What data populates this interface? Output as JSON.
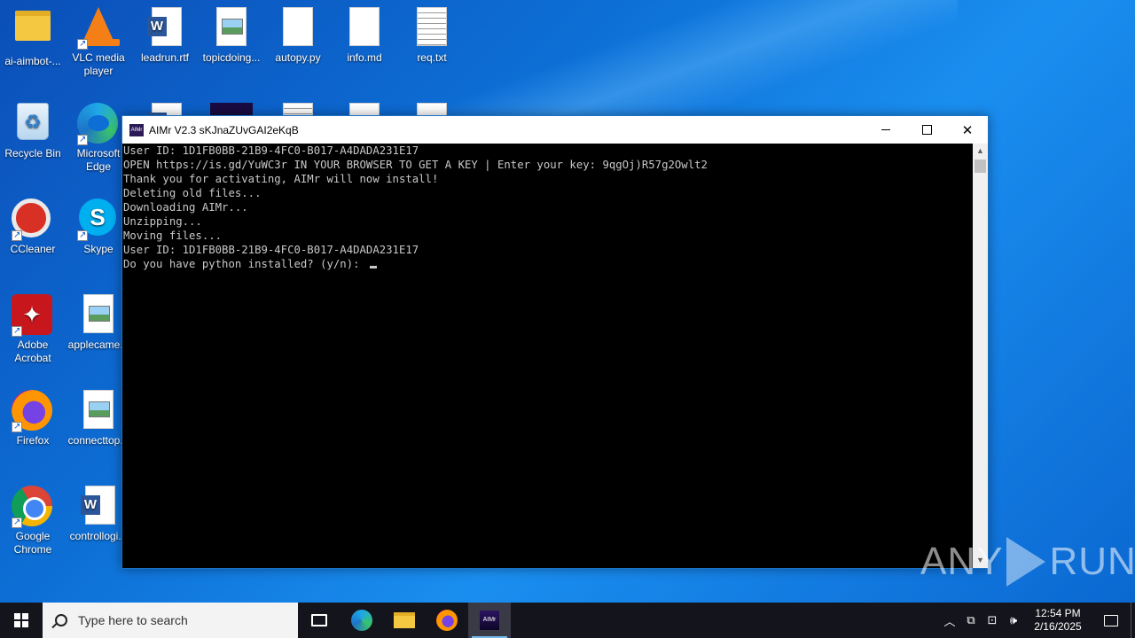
{
  "desktop": {
    "icons": [
      {
        "label": "ai-aimbot-..."
      },
      {
        "label": "VLC media player"
      },
      {
        "label": "leadrun.rtf"
      },
      {
        "label": "topicdoing..."
      },
      {
        "label": "autopy.py"
      },
      {
        "label": "info.md"
      },
      {
        "label": "req.txt"
      },
      {
        "label": "Recycle Bin"
      },
      {
        "label": "Microsoft Edge"
      },
      {
        "label": "CCleaner"
      },
      {
        "label": "Skype"
      },
      {
        "label": "Adobe Acrobat"
      },
      {
        "label": "applecame..."
      },
      {
        "label": "Firefox"
      },
      {
        "label": "connecttop..."
      },
      {
        "label": "Google Chrome"
      },
      {
        "label": "controllogi..."
      }
    ]
  },
  "window": {
    "title": "AIMr V2.3 sKJnaZUvGAI2eKqB",
    "app_badge": "AIMr",
    "console_lines": [
      "User ID: 1D1FB0BB-21B9-4FC0-B017-A4DADA231E17",
      "OPEN https://is.gd/YuWC3r IN YOUR BROWSER TO GET A KEY | Enter your key: 9qgOj)R57g2Owlt2",
      "Thank you for activating, AIMr will now install!",
      "Deleting old files...",
      "Downloading AIMr...",
      "Unzipping...",
      "Moving files...",
      "User ID: 1D1FB0BB-21B9-4FC0-B017-A4DADA231E17",
      "Do you have python installed? (y/n): "
    ]
  },
  "watermark": {
    "left": "ANY",
    "right": "RUN"
  },
  "taskbar": {
    "search_placeholder": "Type here to search",
    "active_app_badge": "AIMr",
    "clock_time": "12:54 PM",
    "clock_date": "2/16/2025"
  }
}
